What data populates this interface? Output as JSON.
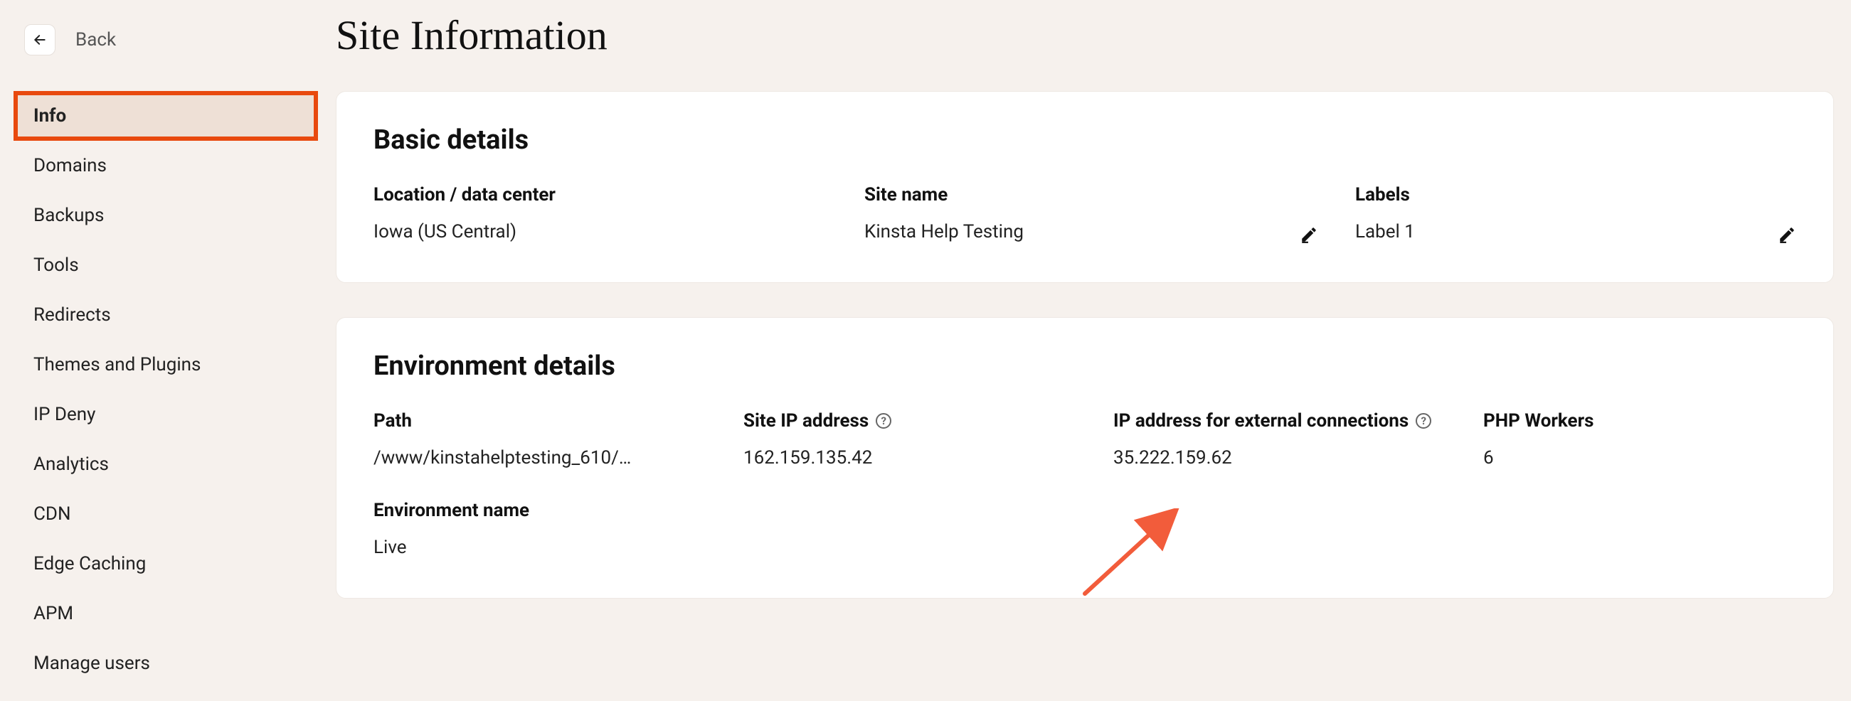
{
  "back": {
    "label": "Back"
  },
  "page_title": "Site Information",
  "sidebar": {
    "items": [
      {
        "label": "Info",
        "active": true
      },
      {
        "label": "Domains"
      },
      {
        "label": "Backups"
      },
      {
        "label": "Tools"
      },
      {
        "label": "Redirects"
      },
      {
        "label": "Themes and Plugins"
      },
      {
        "label": "IP Deny"
      },
      {
        "label": "Analytics"
      },
      {
        "label": "CDN"
      },
      {
        "label": "Edge Caching"
      },
      {
        "label": "APM"
      },
      {
        "label": "Manage users"
      }
    ]
  },
  "basic": {
    "title": "Basic details",
    "location_label": "Location / data center",
    "location_value": "Iowa (US Central)",
    "sitename_label": "Site name",
    "sitename_value": "Kinsta Help Testing",
    "labels_label": "Labels",
    "labels_value": "Label 1"
  },
  "env": {
    "title": "Environment details",
    "path_label": "Path",
    "path_value": "/www/kinstahelptesting_610/…",
    "siteip_label": "Site IP address",
    "siteip_value": "162.159.135.42",
    "extip_label": "IP address for external connections",
    "extip_value": "35.222.159.62",
    "php_label": "PHP Workers",
    "php_value": "6",
    "envname_label": "Environment name",
    "envname_value": "Live"
  },
  "annotation": {
    "type": "arrow",
    "color": "#f25c3b",
    "points_to": "env.extip_value"
  }
}
